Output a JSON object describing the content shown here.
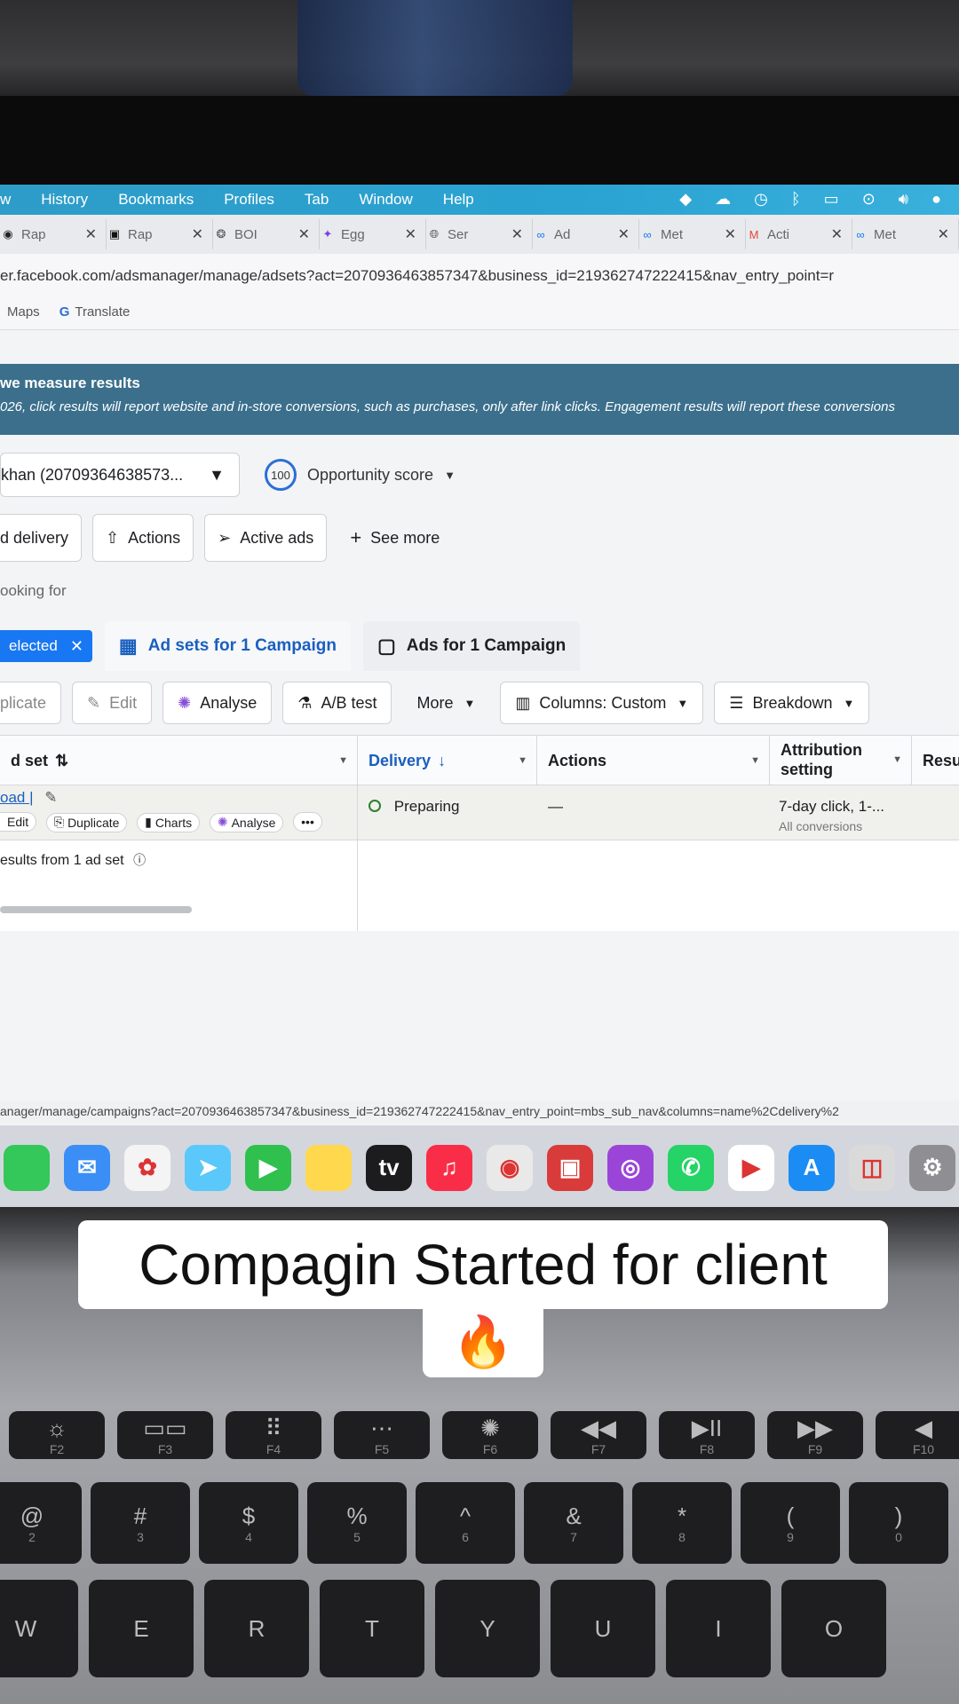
{
  "menubar": {
    "items": [
      "w",
      "History",
      "Bookmarks",
      "Profiles",
      "Tab",
      "Window",
      "Help"
    ]
  },
  "tabs": [
    {
      "label": "Rap",
      "icon": "ring-icon"
    },
    {
      "label": "Rap",
      "icon": "frame-icon"
    },
    {
      "label": "BOI",
      "icon": "openai-icon"
    },
    {
      "label": "Egg",
      "icon": "figma-icon"
    },
    {
      "label": "Ser",
      "icon": "globe-icon"
    },
    {
      "label": "Ad",
      "icon": "meta-icon"
    },
    {
      "label": "Met",
      "icon": "meta-icon"
    },
    {
      "label": "Acti",
      "icon": "gmail-icon"
    },
    {
      "label": "Met",
      "icon": "meta-icon"
    }
  ],
  "url": "er.facebook.com/adsmanager/manage/adsets?act=2070936463857347&business_id=219362747222415&nav_entry_point=r",
  "bookmarks": {
    "maps": "Maps",
    "translate": "Translate"
  },
  "notice": {
    "title": "we measure results",
    "body": "026, click results will report website and in-store conversions, such as purchases, only after link clicks. Engagement results will report these conversions"
  },
  "account": {
    "label": "khan (20709364638573...",
    "opportunity_score": "100",
    "opportunity_label": "Opportunity score"
  },
  "filters": {
    "delivery": "d delivery",
    "actions": "Actions",
    "active_ads": "Active ads",
    "see_more": "See more"
  },
  "search_hint": "ooking for",
  "ad_tabs": {
    "selected": "elected",
    "adsets": "Ad sets for 1 Campaign",
    "ads": "Ads for 1 Campaign"
  },
  "toolbar": {
    "duplicate": "plicate",
    "edit": "Edit",
    "analyse": "Analyse",
    "ab_test": "A/B test",
    "more": "More",
    "columns": "Columns: Custom",
    "breakdown": "Breakdown"
  },
  "table": {
    "headers": {
      "adset": "d set",
      "delivery": "Delivery",
      "actions": "Actions",
      "attribution": "Attribution setting",
      "results": "Resu"
    },
    "row": {
      "name": "oad |",
      "chip_edit": "Edit",
      "chip_duplicate": "Duplicate",
      "chip_charts": "Charts",
      "chip_analyse": "Analyse",
      "chip_more": "•••",
      "delivery": "Preparing",
      "actions": "—",
      "attribution": "7-day click, 1-...",
      "attribution_sub": "All conversions"
    },
    "summary": "esults from 1 ad set"
  },
  "status_url": "anager/manage/campaigns?act=2070936463857347&business_id=219362747222415&nav_entry_point=mbs_sub_nav&columns=name%2Cdelivery%2",
  "dock": [
    {
      "name": "messages-icon",
      "color": "#34c759",
      "glyph": ""
    },
    {
      "name": "mail-icon",
      "color": "#3a8ef6",
      "glyph": "✉"
    },
    {
      "name": "photos-icon",
      "color": "#f4f4f4",
      "glyph": "✿"
    },
    {
      "name": "maps-icon",
      "color": "#5ac8fa",
      "glyph": "➤"
    },
    {
      "name": "facetime-icon",
      "color": "#30c04d",
      "glyph": "▶"
    },
    {
      "name": "notes-icon",
      "color": "#ffd84d",
      "glyph": ""
    },
    {
      "name": "tv-icon",
      "color": "#1c1c1e",
      "glyph": "tv"
    },
    {
      "name": "music-icon",
      "color": "#fa2d48",
      "glyph": "♫"
    },
    {
      "name": "chrome-icon",
      "color": "#e9e9e9",
      "glyph": "◉"
    },
    {
      "name": "photo-booth-icon",
      "color": "#d93b3b",
      "glyph": "▣"
    },
    {
      "name": "podcasts-icon",
      "color": "#9b45d8",
      "glyph": "◎"
    },
    {
      "name": "whatsapp-icon",
      "color": "#25d366",
      "glyph": "✆"
    },
    {
      "name": "youtube-icon",
      "color": "#ffffff",
      "glyph": "▶"
    },
    {
      "name": "app-store-icon",
      "color": "#1c8cf5",
      "glyph": "A"
    },
    {
      "name": "screenshot-icon",
      "color": "#dadada",
      "glyph": "◫"
    },
    {
      "name": "settings-icon",
      "color": "#8e8e93",
      "glyph": "⚙"
    }
  ],
  "caption": {
    "line1": "Compagin Started for client",
    "emoji": "🔥"
  },
  "keyboard": {
    "fn_row": [
      {
        "top": "☼",
        "sub": "F2"
      },
      {
        "top": "▭▭",
        "sub": "F3"
      },
      {
        "top": "⠿",
        "sub": "F4"
      },
      {
        "top": "⋯",
        "sub": "F5"
      },
      {
        "top": "✺",
        "sub": "F6"
      },
      {
        "top": "◀◀",
        "sub": "F7"
      },
      {
        "top": "▶II",
        "sub": "F8"
      },
      {
        "top": "▶▶",
        "sub": "F9"
      },
      {
        "top": "◀",
        "sub": "F10"
      }
    ],
    "num_row": [
      {
        "top": "@",
        "bottom": "2"
      },
      {
        "top": "#",
        "bottom": "3"
      },
      {
        "top": "$",
        "bottom": "4"
      },
      {
        "top": "%",
        "bottom": "5"
      },
      {
        "top": "^",
        "bottom": "6"
      },
      {
        "top": "&",
        "bottom": "7"
      },
      {
        "top": "*",
        "bottom": "8"
      },
      {
        "top": "(",
        "bottom": "9"
      },
      {
        "top": ")",
        "bottom": "0"
      }
    ],
    "letter_row": [
      "W",
      "E",
      "R",
      "T",
      "Y",
      "U",
      "I",
      "O"
    ]
  }
}
